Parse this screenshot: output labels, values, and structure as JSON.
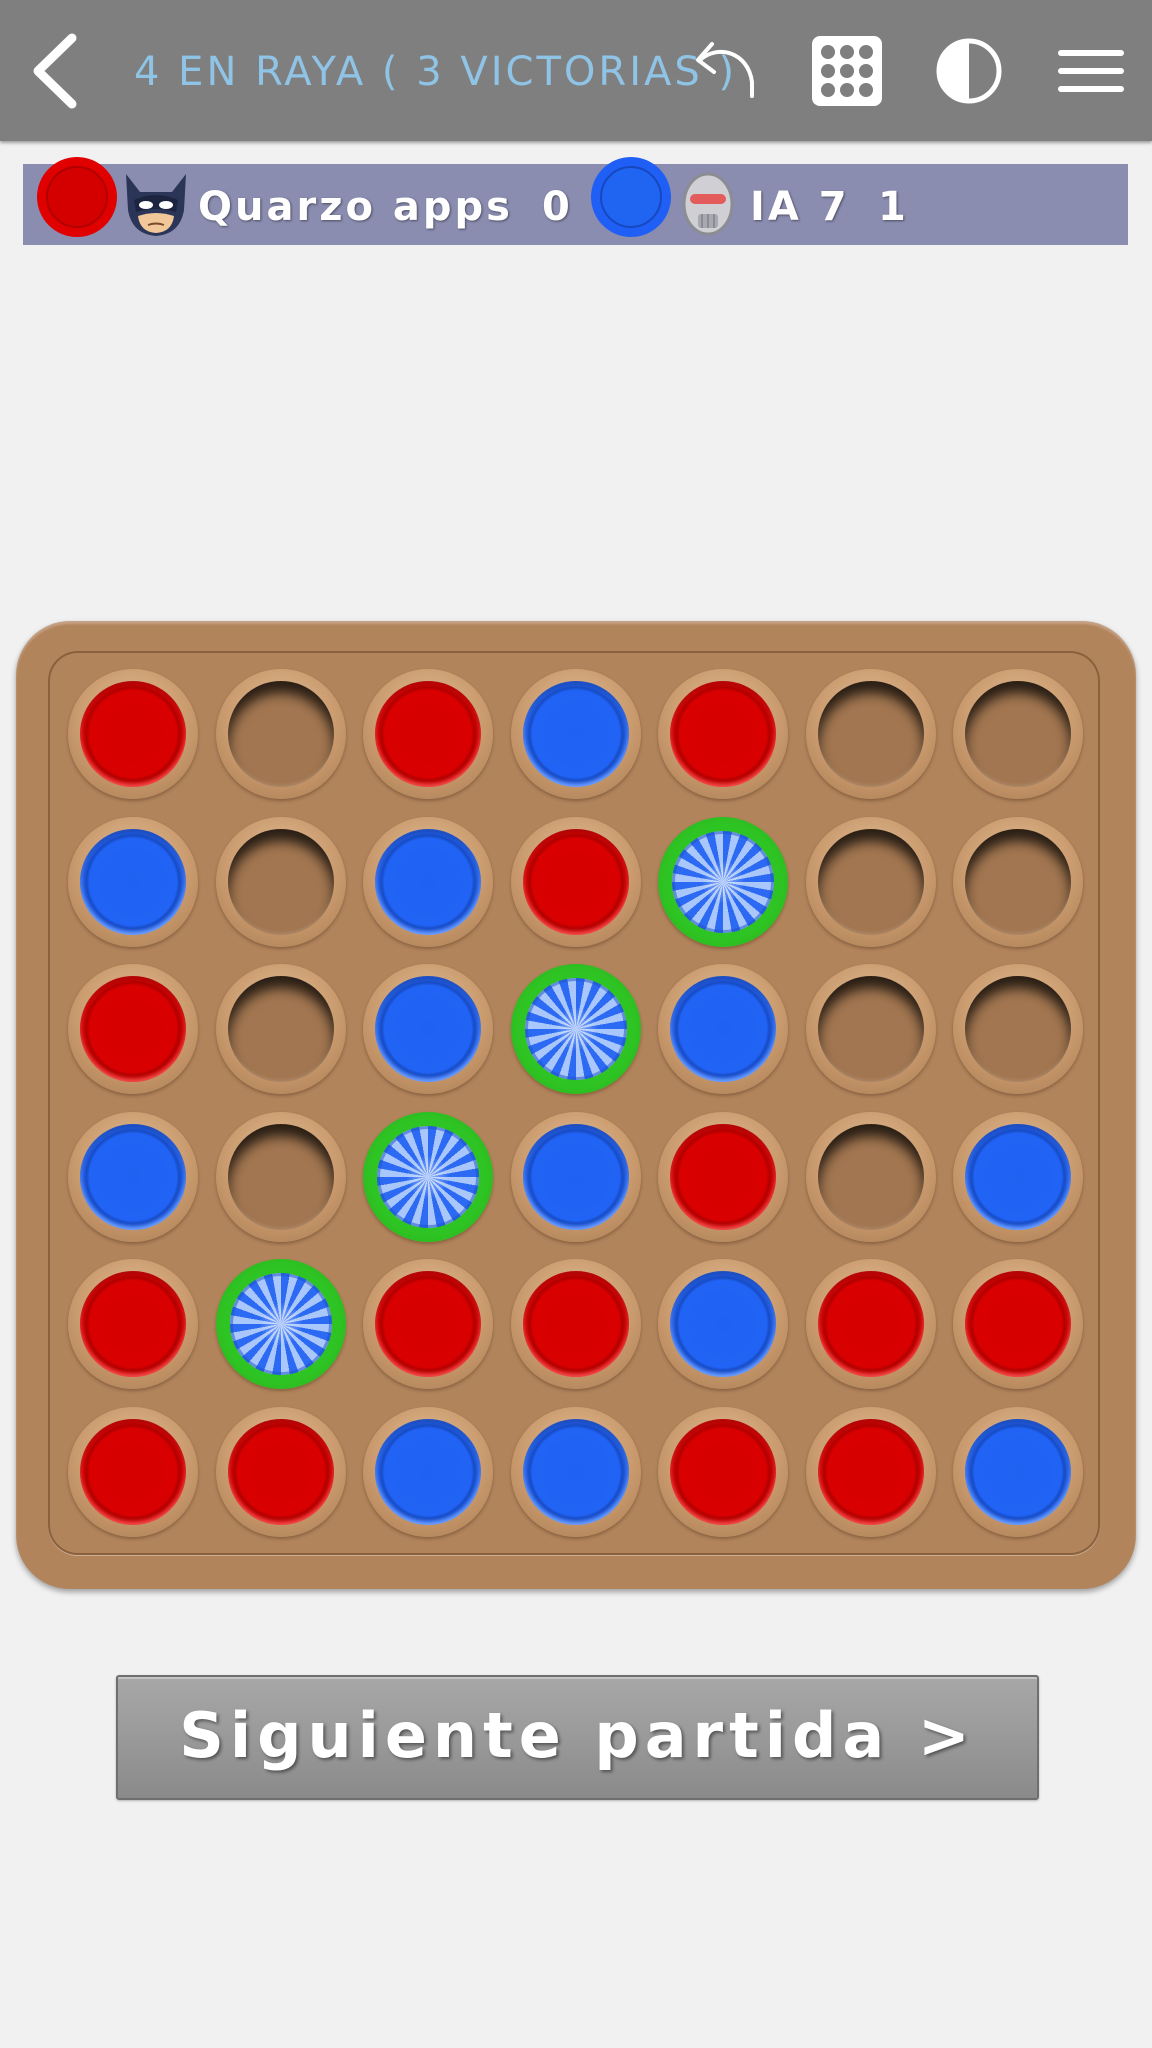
{
  "header": {
    "title": "4 EN RAYA ( 3 VICTORIAS )",
    "back_icon": "chevron-left-icon",
    "undo_icon": "undo-icon",
    "grid_icon": "grid-icon",
    "contrast_icon": "contrast-icon",
    "menu_icon": "hamburger-menu-icon"
  },
  "scoreboard": {
    "player1": {
      "color": "#e00000",
      "avatar": "masked-hero-avatar",
      "name": "Quarzo apps",
      "score": "0"
    },
    "player2": {
      "color": "#1f5ff5",
      "avatar": "robot-avatar",
      "name": "IA 7",
      "score": "1"
    }
  },
  "board": {
    "columns": 7,
    "rows": 6,
    "cells": [
      [
        "red",
        "empty",
        "red",
        "blue",
        "red",
        "empty",
        "empty"
      ],
      [
        "blue",
        "empty",
        "blue",
        "red",
        "blue-win",
        "empty",
        "empty"
      ],
      [
        "red",
        "empty",
        "blue",
        "blue-win",
        "blue",
        "empty",
        "empty"
      ],
      [
        "blue",
        "empty",
        "blue-win",
        "blue",
        "red",
        "empty",
        "blue"
      ],
      [
        "red",
        "blue-win",
        "red",
        "red",
        "blue",
        "red",
        "red"
      ],
      [
        "red",
        "red",
        "blue",
        "blue",
        "red",
        "red",
        "blue"
      ]
    ],
    "colors": {
      "board": "#b2845c",
      "red": "#d90000",
      "blue": "#2164f5",
      "win_ring": "#2ec423"
    }
  },
  "next_button": {
    "label": "Siguiente partida >"
  }
}
